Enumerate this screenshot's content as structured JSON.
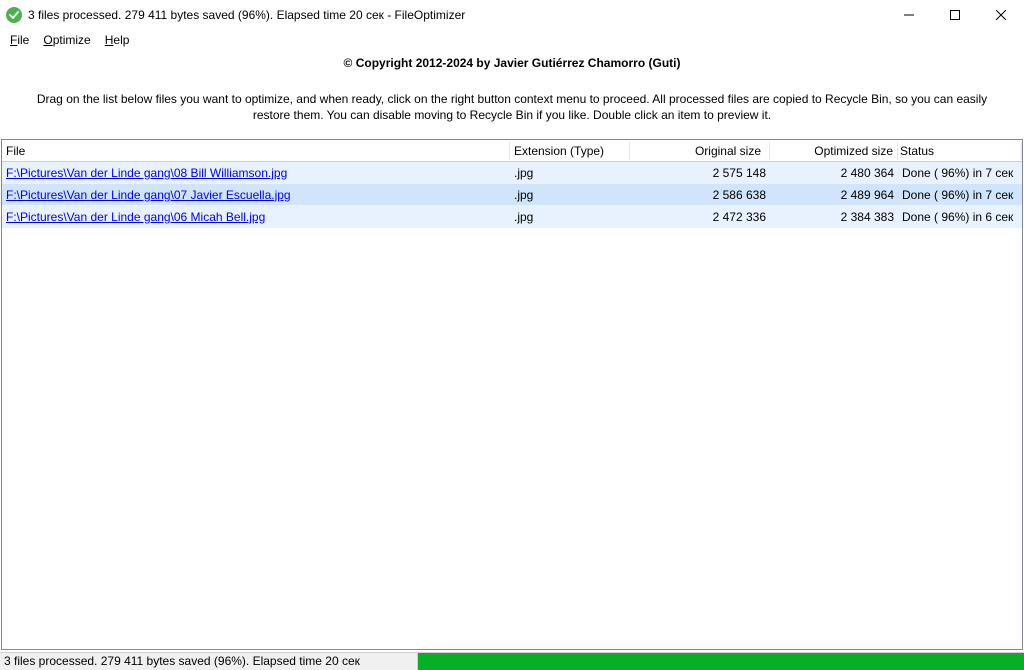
{
  "window": {
    "title": "3 files processed. 279 411 bytes saved (96%). Elapsed time  20 сек - FileOptimizer"
  },
  "menu": {
    "file": "File",
    "optimize": "Optimize",
    "help": "Help"
  },
  "copyright": "© Copyright 2012-2024 by Javier Gutiérrez Chamorro (Guti)",
  "instructions": "Drag on the list below files you want to optimize, and when ready, click on the right button context menu to proceed. All processed files are copied to Recycle Bin, so you can easily restore them. You can disable moving to Recycle Bin if you like. Double click an item to preview it.",
  "columns": {
    "file": "File",
    "ext": "Extension (Type)",
    "orig": "Original size",
    "opt": "Optimized size",
    "status": "Status"
  },
  "rows": [
    {
      "file": "F:\\Pictures\\Van der Linde gang\\08 Bill Williamson.jpg",
      "ext": ".jpg",
      "orig": "2 575 148",
      "opt": "2 480 364",
      "status": "Done ( 96%) in  7 сек"
    },
    {
      "file": "F:\\Pictures\\Van der Linde gang\\07 Javier Escuella.jpg",
      "ext": ".jpg",
      "orig": "2 586 638",
      "opt": "2 489 964",
      "status": "Done ( 96%) in  7 сек"
    },
    {
      "file": "F:\\Pictures\\Van der Linde gang\\06 Micah Bell.jpg",
      "ext": ".jpg",
      "orig": "2 472 336",
      "opt": "2 384 383",
      "status": "Done ( 96%) in  6 сек"
    }
  ],
  "status": {
    "text": "3 files processed. 279 411 bytes saved (96%). Elapsed time  20 сек",
    "progress_percent": 100
  }
}
